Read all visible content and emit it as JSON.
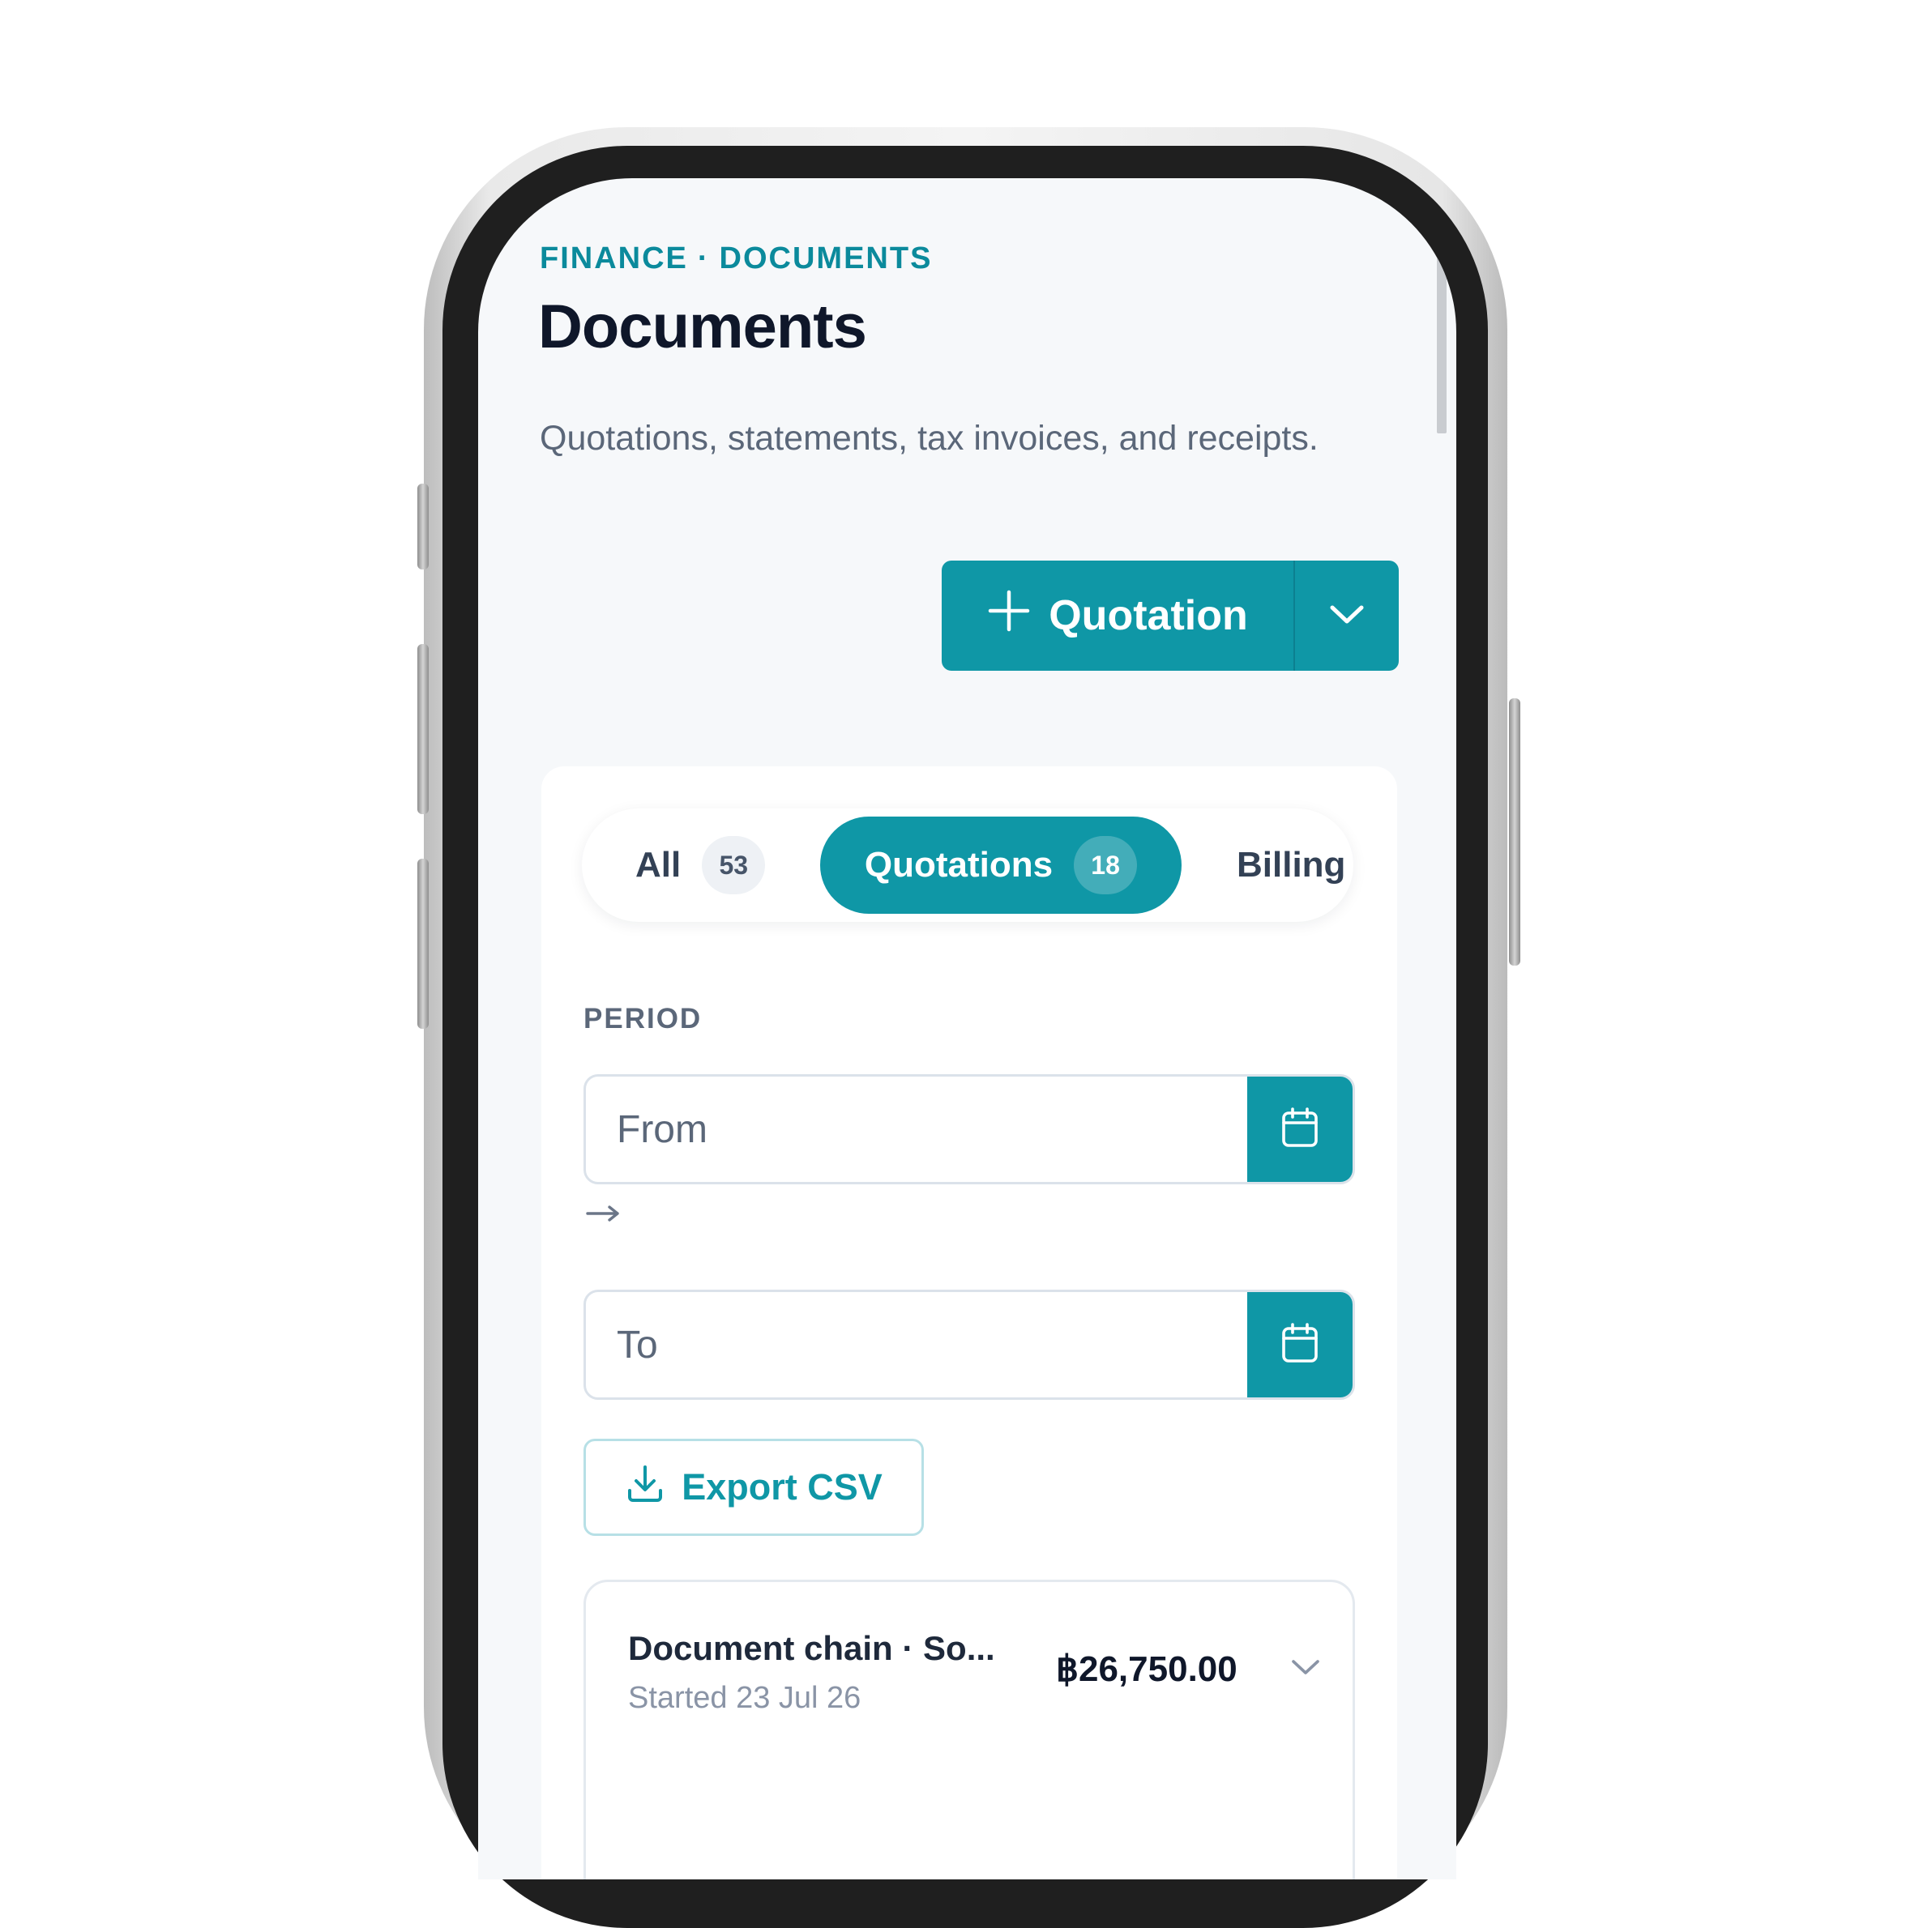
{
  "header": {
    "breadcrumb": [
      "FINANCE",
      "DOCUMENTS"
    ],
    "breadcrumb_separator": "·",
    "title": "Documents",
    "description": "Quotations, statements, tax invoices, and receipts."
  },
  "create_button": {
    "label": "Quotation",
    "icon": "plus-icon",
    "menu_icon": "chevron-down-icon"
  },
  "tabs": [
    {
      "label": "All",
      "count": "53",
      "active": false
    },
    {
      "label": "Quotations",
      "count": "18",
      "active": true
    },
    {
      "label": "Billing",
      "active": false
    }
  ],
  "period": {
    "label": "PERIOD",
    "from_placeholder": "From",
    "to_placeholder": "To",
    "arrow": "→",
    "calendar_icon": "calendar-icon"
  },
  "export": {
    "label": "Export CSV",
    "icon": "download-icon"
  },
  "documents": [
    {
      "title": "Document chain · So...",
      "subtitle": "Started 23 Jul 26",
      "amount": "฿26,750.00",
      "expand_icon": "chevron-down-icon"
    }
  ],
  "colors": {
    "accent": "#0f97a6",
    "breadcrumb": "#0b8a9c",
    "title": "#0f172a",
    "muted": "#5b6779",
    "screen_bg": "#f6f8fa"
  }
}
